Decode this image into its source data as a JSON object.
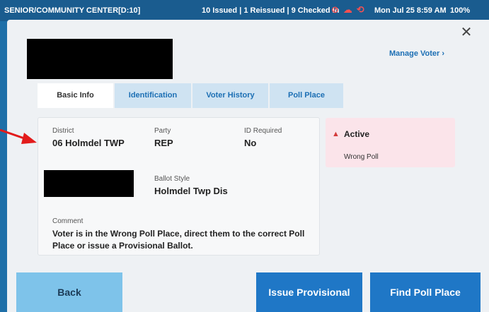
{
  "status_bar": {
    "site": "SENIOR/COMMUNITY CENTER[D:10]",
    "counts": "10 Issued | 1 Reissued | 9 Checked In",
    "clock": "Mon Jul 25  8:59 AM",
    "battery": "100%"
  },
  "header": {
    "manage_label": "Manage Voter",
    "manage_chevron": "›",
    "close_glyph": "✕"
  },
  "tabs": [
    {
      "label": "Basic Info"
    },
    {
      "label": "Identification"
    },
    {
      "label": "Voter History"
    },
    {
      "label": "Poll Place"
    }
  ],
  "info": {
    "district_label": "District",
    "district_value": "06 Holmdel TWP",
    "party_label": "Party",
    "party_value": "REP",
    "id_label": "ID Required",
    "id_value": "No",
    "ballot_label": "Ballot Style",
    "ballot_value": "Holmdel Twp Dis",
    "comment_label": "Comment",
    "comment_text": "Voter is in the Wrong Poll Place, direct them to the correct Poll Place or issue a Provisional Ballot."
  },
  "status_card": {
    "warn_glyph": "▲",
    "title": "Active",
    "subtitle": "Wrong Poll"
  },
  "buttons": {
    "back": "Back",
    "issue_provisional": "Issue Provisional",
    "find_poll_place": "Find Poll Place"
  },
  "colors": {
    "brand_blue": "#1f77c6",
    "status_pink": "#fbe4ea",
    "warn_red": "#d43b3b",
    "annotation_red": "#e21b1b"
  }
}
